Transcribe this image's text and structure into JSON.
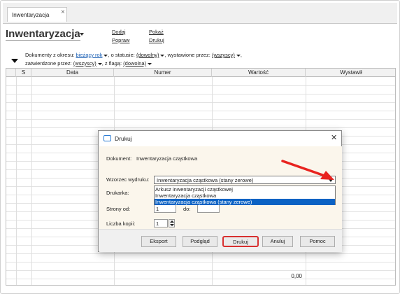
{
  "tab": {
    "label": "Inwentaryzacja",
    "close": "×"
  },
  "header": {
    "title": "Inwentaryzacja",
    "actions": {
      "dodaj": "Dodaj",
      "popraw": "Popraw",
      "pokaz": "Pokaż",
      "drukuj": "Drukuj"
    }
  },
  "filters": {
    "okres_label": "Dokumenty z okresu:",
    "okres_value": "bieżący rok",
    "status_label": ", o statusie:",
    "status_value": "(dowolny)",
    "wystawione_label": ", wystawione przez:",
    "wystawione_value": "(wszyscy)",
    "zatwierdzone_label": "zatwierdzone przez:",
    "zatwierdzone_value": "(wszyscy)",
    "flaga_label": ", z flagą:",
    "flaga_value": "(dowolna)"
  },
  "grid": {
    "columns": [
      "S",
      "Data",
      "Numer",
      "Wartość",
      "Wystawił"
    ],
    "total": "0,00"
  },
  "dialog": {
    "title": "Drukuj",
    "close": "✕",
    "document_label": "Dokument:",
    "document_value": "Inwentaryzacja cząstkowa",
    "wzorzec_label": "Wzorzec wydruku:",
    "wzorzec_value": "Inwentaryzacja cząstkowa (stany zerowe)",
    "options": [
      "Arkusz inwentaryzacji cząstkowej",
      "Inwentaryzacja cząstkowa",
      "Inwentaryzacja cząstkowa (stany zerowe)"
    ],
    "drukarka_label": "Drukarka:",
    "strony_label": "Strony od:",
    "strony_from": "1",
    "strony_to_label": "do:",
    "strony_to": "",
    "kopie_label": "Liczba kopii:",
    "kopie_value": "1",
    "buttons": {
      "eksport": "Eksport",
      "podglad": "Podgląd",
      "drukuj": "Drukuj",
      "anuluj": "Anuluj",
      "pomoc": "Pomoc"
    }
  },
  "colors": {
    "accent_arrow": "#e8231f",
    "selection": "#0b62c4",
    "link_blue": "#1a5fb4"
  }
}
